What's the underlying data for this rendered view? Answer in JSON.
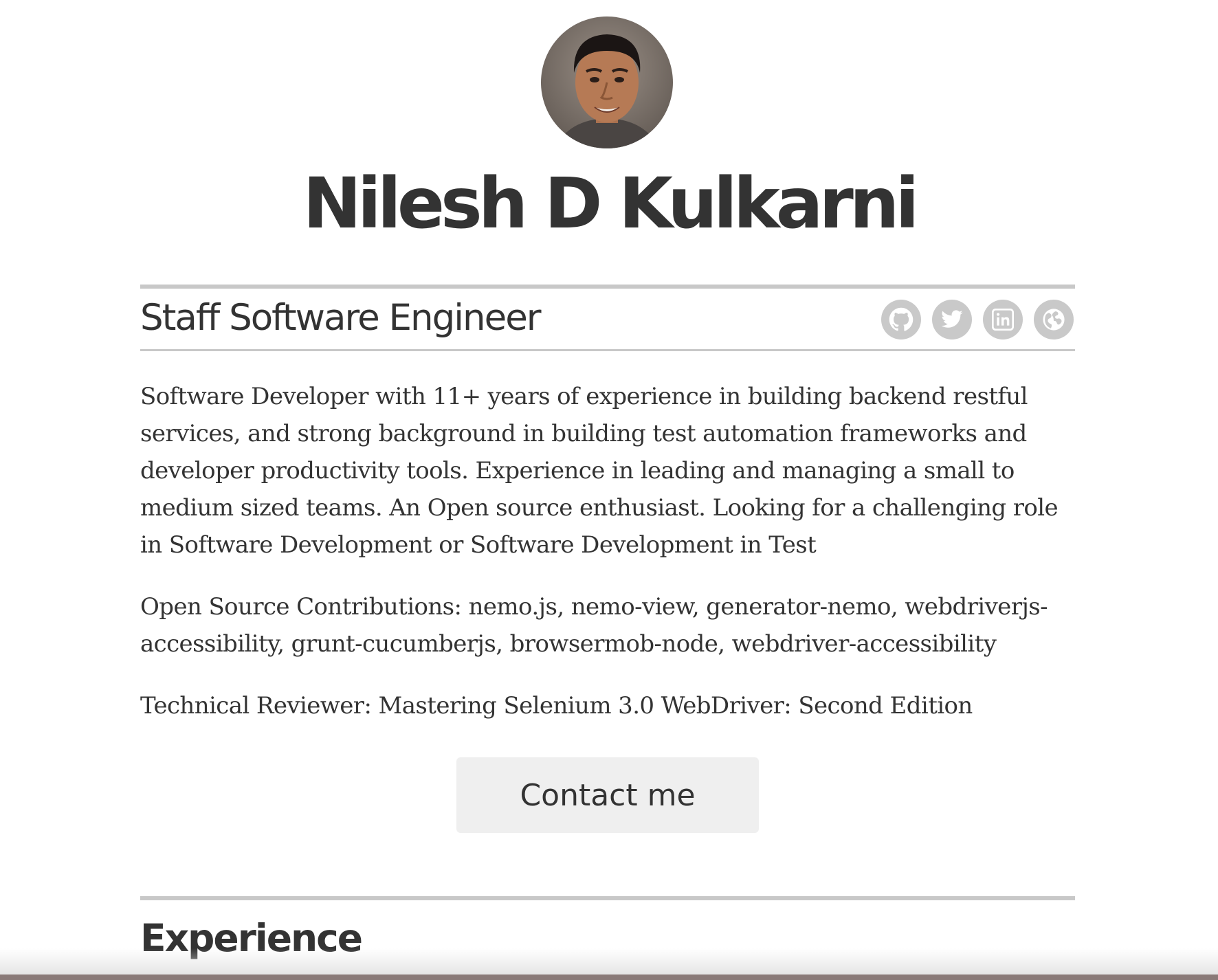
{
  "profile": {
    "name": "Nilesh D Kulkarni",
    "title": "Staff Software Engineer",
    "avatar_icon": "profile-photo"
  },
  "social": [
    {
      "icon": "github-icon",
      "label": "GitHub"
    },
    {
      "icon": "twitter-icon",
      "label": "Twitter"
    },
    {
      "icon": "linkedin-icon",
      "label": "LinkedIn"
    },
    {
      "icon": "globe-icon",
      "label": "Website"
    }
  ],
  "summary": {
    "paragraphs": [
      "Software Developer with 11+ years of experience in building backend restful services, and strong background in building test automation frameworks and developer productivity tools. Experience in leading and managing a small to medium sized teams. An Open source enthusiast. Looking for a challenging role in Software Development or Software Development in Test",
      "Open Source Contributions: nemo.js, nemo-view, generator-nemo, webdriverjs-accessibility, grunt-cucumberjs, browsermob-node, webdriver-accessibility",
      "Technical Reviewer: Mastering Selenium 3.0 WebDriver: Second Edition"
    ]
  },
  "contact": {
    "button_label": "Contact me"
  },
  "sections": {
    "experience_title": "Experience"
  },
  "colors": {
    "text": "#333333",
    "rule": "#c8c8c8",
    "social_icon_bg": "#c9c9c9",
    "button_bg": "#efefef"
  }
}
